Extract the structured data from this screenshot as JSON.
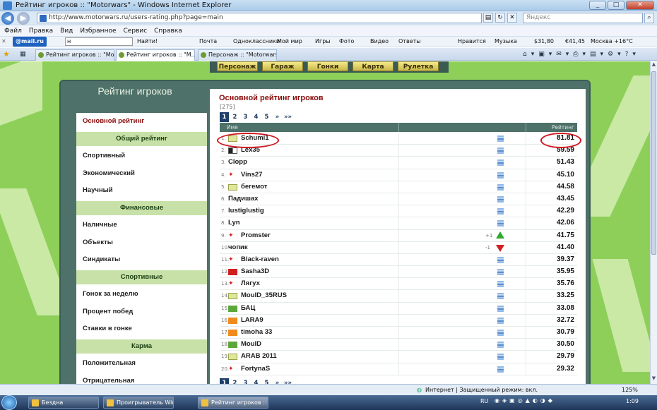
{
  "window": {
    "title": "Рейтинг игроков :: \"Motorwars\" - Windows Internet Explorer"
  },
  "address": {
    "url": "http://www.motorwars.ru/users-rating.php?page=main",
    "search_placeholder": "Яндекс"
  },
  "menu": [
    "Файл",
    "Правка",
    "Вид",
    "Избранное",
    "Сервис",
    "Справка"
  ],
  "toolbar": {
    "mailru": "@mail.ru",
    "input_value": "н",
    "find_label": "Найти!",
    "items": [
      "Почта",
      "Одноклассники",
      "Мой мир",
      "Игры",
      "Фото",
      "Видео",
      "Ответы"
    ],
    "right_items": [
      "Нравится",
      "Музыка",
      "$31,80",
      "€41,45",
      "Москва +16°C"
    ]
  },
  "tabs": [
    {
      "label": "Рейтинг игроков :: \"Moto...\""
    },
    {
      "label": "Рейтинг игроков :: \"M...\""
    },
    {
      "label": "Персонаж :: \"Motorwars\""
    }
  ],
  "site": {
    "topnav": [
      "Персонаж",
      "Гараж",
      "Гонки",
      "Карта",
      "Рулетка"
    ],
    "panel_title": "Рейтинг игроков",
    "sidebar": [
      {
        "type": "item",
        "label": "Основной рейтинг",
        "active": true
      },
      {
        "type": "header",
        "label": "Общий рейтинг"
      },
      {
        "type": "item",
        "label": "Спортивный"
      },
      {
        "type": "item",
        "label": "Экономический"
      },
      {
        "type": "item",
        "label": "Научный"
      },
      {
        "type": "header",
        "label": "Финансовые"
      },
      {
        "type": "item",
        "label": "Наличные"
      },
      {
        "type": "item",
        "label": "Объекты"
      },
      {
        "type": "item",
        "label": "Синдикаты"
      },
      {
        "type": "header",
        "label": "Спортивные"
      },
      {
        "type": "item",
        "label": "Гонок за неделю"
      },
      {
        "type": "item",
        "label": "Процент побед"
      },
      {
        "type": "item",
        "label": "Ставки в гонке"
      },
      {
        "type": "header",
        "label": "Карма"
      },
      {
        "type": "item",
        "label": "Положительная"
      },
      {
        "type": "item",
        "label": "Отрицательная"
      }
    ],
    "content_title": "Основной рейтинг игроков",
    "count": "[275]",
    "pager": [
      "1",
      "2",
      "3",
      "4",
      "5",
      "»",
      "»»"
    ],
    "columns": {
      "name": "Имя",
      "rating": "Рейтинг"
    },
    "rows": [
      {
        "n": "1.",
        "name": "Schumi1",
        "flag": "skull",
        "value": "81.81"
      },
      {
        "n": "2.",
        "name": "Lex35",
        "flag": "bw",
        "value": "59.59"
      },
      {
        "n": "3.",
        "name": "Clopp",
        "flag": "",
        "value": "51.43"
      },
      {
        "n": "4.",
        "name": "Vins27",
        "flag": "redcar",
        "value": "45.10"
      },
      {
        "n": "5.",
        "name": "бегемот",
        "flag": "skull",
        "value": "44.58"
      },
      {
        "n": "6.",
        "name": "Падишах",
        "flag": "",
        "value": "43.45"
      },
      {
        "n": "7.",
        "name": "lustiglustig",
        "flag": "",
        "value": "42.29"
      },
      {
        "n": "8.",
        "name": "Lyn",
        "flag": "",
        "value": "42.06"
      },
      {
        "n": "9.",
        "name": "Promster",
        "flag": "redcar",
        "value": "41.75",
        "delta": "+1",
        "trend": "up"
      },
      {
        "n": "10.",
        "name": "чопик",
        "flag": "",
        "value": "41.40",
        "delta": "-1",
        "trend": "down"
      },
      {
        "n": "11.",
        "name": "Black-raven",
        "flag": "redcar",
        "value": "39.37"
      },
      {
        "n": "12.",
        "name": "Sasha3D",
        "flag": "sickle",
        "value": "35.95"
      },
      {
        "n": "13.",
        "name": "Лягух",
        "flag": "redcar",
        "value": "35.76"
      },
      {
        "n": "14.",
        "name": "MoulD_35RUS",
        "flag": "skull",
        "value": "33.25"
      },
      {
        "n": "15.",
        "name": "БАЦ",
        "flag": "green",
        "value": "33.08"
      },
      {
        "n": "16.",
        "name": "LARA9",
        "flag": "orange",
        "value": "32.72"
      },
      {
        "n": "17.",
        "name": "timoha 33",
        "flag": "orange",
        "value": "30.79"
      },
      {
        "n": "18.",
        "name": "MoulD",
        "flag": "green",
        "value": "30.50"
      },
      {
        "n": "19.",
        "name": "ARAB 2011",
        "flag": "skull",
        "value": "29.79"
      },
      {
        "n": "20.",
        "name": "FortynaS",
        "flag": "redcar",
        "value": "29.32"
      }
    ]
  },
  "status": {
    "zone": "Интернет | Защищенный режим: вкл.",
    "zoom": "125%"
  },
  "taskbar": {
    "buttons": [
      "Бездна",
      "Проигрыватель Win...",
      "Рейтинг игроков :: \"..."
    ],
    "lang": "RU",
    "time": "1:09"
  },
  "colors": {
    "accent": "#8a0b0b",
    "panel": "#4e7169",
    "highlight": "#d0141e",
    "sidebar_header": "#c7e1a8"
  }
}
